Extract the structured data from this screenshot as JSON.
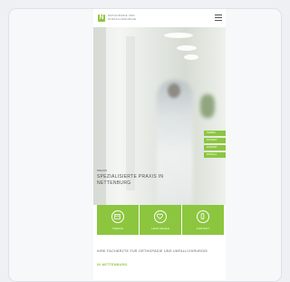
{
  "header": {
    "logo_letter": "N",
    "logo_text": "ORTHOPÄDIE UND UNFALLCHIRURGIE"
  },
  "hero": {
    "kicker": "PRAXIS",
    "title": "SPEZIALISIERTE PRAXIS IN NETTENBURG",
    "side_tabs": [
      "TERMIN",
      "KONTAKT",
      "ANFAHRT",
      "NOTFALL"
    ]
  },
  "cards": [
    {
      "label": "TERMIN",
      "icon": "calendar-icon"
    },
    {
      "label": "LEISTUNGEN",
      "icon": "heart-icon"
    },
    {
      "label": "KONTAKT",
      "icon": "phone-icon"
    }
  ],
  "intro": {
    "text": "IHRE FACHÄRZTE FÜR ORTHOPÄDIE UND UNFALLCHIRURGIE",
    "accent": "IN NETTENBURG."
  },
  "colors": {
    "brand_green": "#8cc63f",
    "page_bg": "#eef0f3"
  }
}
